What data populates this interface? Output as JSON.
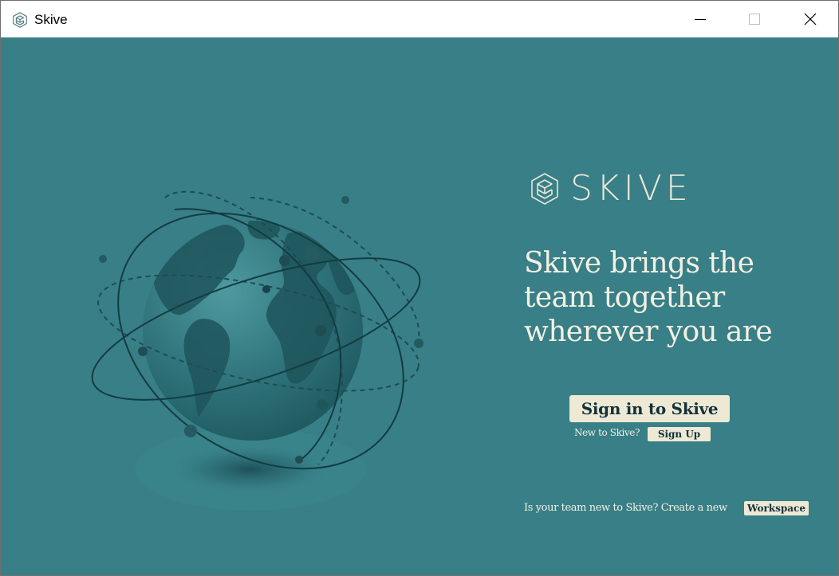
{
  "window": {
    "title": "Skive",
    "controls": {
      "minimize": "minimize-icon",
      "maximize": "maximize-icon",
      "close": "close-icon"
    }
  },
  "brand": {
    "logo_text": "SKIVE",
    "logo_icon": "skive-logo-icon"
  },
  "hero": {
    "tagline_lines": [
      "Skive brings the",
      "team together",
      "wherever you are"
    ],
    "illustration": "globe-illustration"
  },
  "auth": {
    "signin_label": "Sign in to Skive",
    "new_prompt": "New to Skive?",
    "signup_label": "Sign Up",
    "workspace_prompt": "Is your team new to Skive? Create a new",
    "workspace_label": "Workspace"
  },
  "colors": {
    "background": "#387f87",
    "button": "#ede9d5",
    "button_text": "#14313a",
    "text": "#f3f0e2"
  }
}
